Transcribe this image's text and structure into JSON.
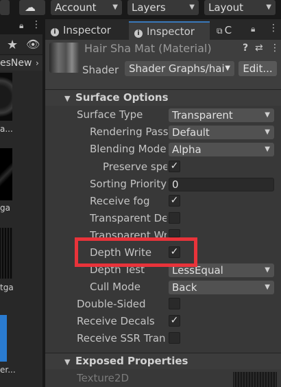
{
  "toolbar": {
    "account_label": "Account",
    "layers_label": "Layers",
    "layout_label": "Layout"
  },
  "project_panel": {
    "breadcrumb": "esNew",
    "assets": [
      {
        "label": "a..."
      },
      {
        "label": "ga"
      },
      {
        "label": "tga"
      },
      {
        "label": "er..."
      }
    ]
  },
  "inspector": {
    "tabs": [
      {
        "label": "Inspector"
      },
      {
        "label": "Inspector"
      },
      {
        "label": "C"
      }
    ],
    "material_title": "Hair Sha Mat (Material)",
    "shader_label": "Shader",
    "shader_value": "Shader Graphs/hai",
    "edit_label": "Edit...",
    "surface_options": {
      "title": "Surface Options",
      "rows": [
        {
          "label": "Surface Type",
          "value": "Transparent"
        },
        {
          "label": "Rendering Pass",
          "value": "Default"
        },
        {
          "label": "Blending Mode",
          "value": "Alpha"
        },
        {
          "label": "Preserve spe",
          "checked": true
        },
        {
          "label": "Sorting Priority",
          "value": "0"
        },
        {
          "label": "Receive fog",
          "checked": true
        },
        {
          "label": "Transparent De",
          "checked": false
        },
        {
          "label": "Transparent Wr",
          "checked": false
        },
        {
          "label": "Depth Write",
          "checked": true
        },
        {
          "label": "Depth Test",
          "value": "LessEqual"
        },
        {
          "label": "Cull Mode",
          "value": "Back"
        },
        {
          "label": "Double-Sided",
          "checked": false
        },
        {
          "label": "Receive Decals",
          "checked": true
        },
        {
          "label": "Receive SSR Tran",
          "checked": false
        }
      ]
    },
    "exposed_properties": {
      "title": "Exposed Properties",
      "first_label": "Texture2D"
    }
  },
  "colors": {
    "highlight": "#e8333a",
    "active_tab_accent": "#3a79bb"
  }
}
